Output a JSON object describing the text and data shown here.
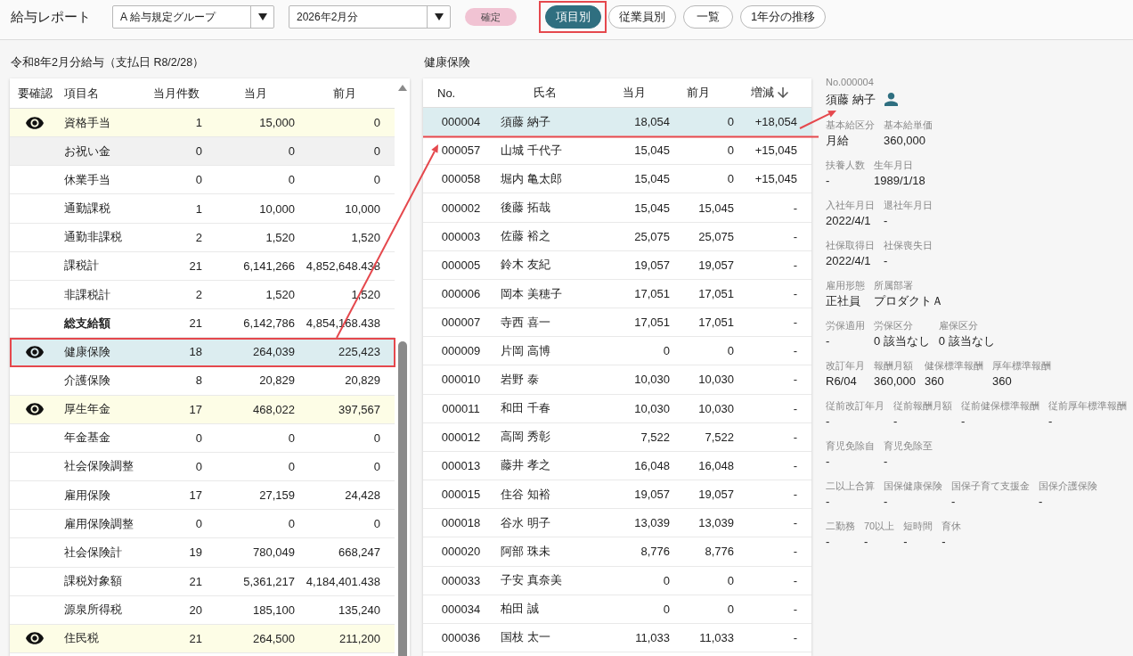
{
  "header": {
    "title": "給与レポート",
    "group_select": {
      "value": "A 給与規定グループ"
    },
    "month_select": {
      "value": "2026年2月分"
    },
    "status_badge": "確定",
    "view_buttons": [
      {
        "label": "項目別",
        "selected": true
      },
      {
        "label": "従業員別",
        "selected": false
      },
      {
        "label": "一覧",
        "selected": false
      },
      {
        "label": "1年分の推移",
        "selected": false
      }
    ]
  },
  "items_panel": {
    "title": "令和8年2月分給与（支払日 R8/2/28）",
    "columns": [
      "要確認",
      "項目名",
      "当月件数",
      "当月",
      "前月"
    ],
    "rows": [
      {
        "name": "資格手当",
        "count": "1",
        "current": "15,000",
        "previous": "0",
        "kind": "item",
        "flagged": true,
        "selected": false,
        "hovered": false
      },
      {
        "name": "お祝い金",
        "count": "0",
        "current": "0",
        "previous": "0",
        "kind": "item",
        "flagged": false,
        "selected": false,
        "hovered": true
      },
      {
        "name": "休業手当",
        "count": "0",
        "current": "0",
        "previous": "0",
        "kind": "item",
        "flagged": false,
        "selected": false,
        "hovered": false
      },
      {
        "name": "通勤課税",
        "count": "1",
        "current": "10,000",
        "previous": "10,000",
        "kind": "item",
        "flagged": false,
        "selected": false,
        "hovered": false
      },
      {
        "name": "通勤非課税",
        "count": "2",
        "current": "1,520",
        "previous": "1,520",
        "kind": "item",
        "flagged": false,
        "selected": false,
        "hovered": false
      },
      {
        "name": "課税計",
        "count": "21",
        "current": "6,141,266",
        "previous": "4,852,648.438",
        "kind": "item",
        "flagged": false,
        "selected": false,
        "hovered": false
      },
      {
        "name": "非課税計",
        "count": "2",
        "current": "1,520",
        "previous": "1,520",
        "kind": "item",
        "flagged": false,
        "selected": false,
        "hovered": false
      },
      {
        "name": "総支給額",
        "count": "21",
        "current": "6,142,786",
        "previous": "4,854,168.438",
        "kind": "total",
        "flagged": false,
        "selected": false,
        "hovered": false
      },
      {
        "name": "健康保険",
        "count": "18",
        "current": "264,039",
        "previous": "225,423",
        "kind": "item",
        "flagged": true,
        "selected": true,
        "hovered": false
      },
      {
        "name": "介護保険",
        "count": "8",
        "current": "20,829",
        "previous": "20,829",
        "kind": "item",
        "flagged": false,
        "selected": false,
        "hovered": false
      },
      {
        "name": "厚生年金",
        "count": "17",
        "current": "468,022",
        "previous": "397,567",
        "kind": "item",
        "flagged": true,
        "selected": false,
        "hovered": false
      },
      {
        "name": "年金基金",
        "count": "0",
        "current": "0",
        "previous": "0",
        "kind": "item",
        "flagged": false,
        "selected": false,
        "hovered": false
      },
      {
        "name": "社会保険調整",
        "count": "0",
        "current": "0",
        "previous": "0",
        "kind": "item",
        "flagged": false,
        "selected": false,
        "hovered": false
      },
      {
        "name": "雇用保険",
        "count": "17",
        "current": "27,159",
        "previous": "24,428",
        "kind": "item",
        "flagged": false,
        "selected": false,
        "hovered": false
      },
      {
        "name": "雇用保険調整",
        "count": "0",
        "current": "0",
        "previous": "0",
        "kind": "item",
        "flagged": false,
        "selected": false,
        "hovered": false
      },
      {
        "name": "社会保険計",
        "count": "19",
        "current": "780,049",
        "previous": "668,247",
        "kind": "item",
        "flagged": false,
        "selected": false,
        "hovered": false
      },
      {
        "name": "課税対象額",
        "count": "21",
        "current": "5,361,217",
        "previous": "4,184,401.438",
        "kind": "item",
        "flagged": false,
        "selected": false,
        "hovered": false
      },
      {
        "name": "源泉所得税",
        "count": "20",
        "current": "185,100",
        "previous": "135,240",
        "kind": "item",
        "flagged": false,
        "selected": false,
        "hovered": false
      },
      {
        "name": "住民税",
        "count": "21",
        "current": "264,500",
        "previous": "211,200",
        "kind": "item",
        "flagged": true,
        "selected": false,
        "hovered": false
      }
    ]
  },
  "employees_panel": {
    "title": "健康保険",
    "columns": [
      {
        "label": "No.",
        "sorted": false
      },
      {
        "label": "氏名",
        "sorted": false
      },
      {
        "label": "当月",
        "sorted": false
      },
      {
        "label": "前月",
        "sorted": false
      },
      {
        "label": "増減",
        "sorted": true
      }
    ],
    "rows": [
      {
        "no": "000004",
        "name": "須藤 納子",
        "current": "18,054",
        "previous": "0",
        "change": "+18,054",
        "selected": true
      },
      {
        "no": "000057",
        "name": "山城 千代子",
        "current": "15,045",
        "previous": "0",
        "change": "+15,045",
        "selected": false
      },
      {
        "no": "000058",
        "name": "堀内 亀太郎",
        "current": "15,045",
        "previous": "0",
        "change": "+15,045",
        "selected": false
      },
      {
        "no": "000002",
        "name": "後藤 拓哉",
        "current": "15,045",
        "previous": "15,045",
        "change": "-",
        "selected": false
      },
      {
        "no": "000003",
        "name": "佐藤 裕之",
        "current": "25,075",
        "previous": "25,075",
        "change": "-",
        "selected": false
      },
      {
        "no": "000005",
        "name": "鈴木 友紀",
        "current": "19,057",
        "previous": "19,057",
        "change": "-",
        "selected": false
      },
      {
        "no": "000006",
        "name": "岡本 美穂子",
        "current": "17,051",
        "previous": "17,051",
        "change": "-",
        "selected": false
      },
      {
        "no": "000007",
        "name": "寺西 喜一",
        "current": "17,051",
        "previous": "17,051",
        "change": "-",
        "selected": false
      },
      {
        "no": "000009",
        "name": "片岡 高博",
        "current": "0",
        "previous": "0",
        "change": "-",
        "selected": false
      },
      {
        "no": "000010",
        "name": "岩野 泰",
        "current": "10,030",
        "previous": "10,030",
        "change": "-",
        "selected": false
      },
      {
        "no": "000011",
        "name": "和田 千春",
        "current": "10,030",
        "previous": "10,030",
        "change": "-",
        "selected": false
      },
      {
        "no": "000012",
        "name": "高岡 秀彰",
        "current": "7,522",
        "previous": "7,522",
        "change": "-",
        "selected": false
      },
      {
        "no": "000013",
        "name": "藤井 孝之",
        "current": "16,048",
        "previous": "16,048",
        "change": "-",
        "selected": false
      },
      {
        "no": "000015",
        "name": "住谷 知裕",
        "current": "19,057",
        "previous": "19,057",
        "change": "-",
        "selected": false
      },
      {
        "no": "000018",
        "name": "谷水 明子",
        "current": "13,039",
        "previous": "13,039",
        "change": "-",
        "selected": false
      },
      {
        "no": "000020",
        "name": "阿部 珠未",
        "current": "8,776",
        "previous": "8,776",
        "change": "-",
        "selected": false
      },
      {
        "no": "000033",
        "name": "子安 真奈美",
        "current": "0",
        "previous": "0",
        "change": "-",
        "selected": false
      },
      {
        "no": "000034",
        "name": "柏田 誠",
        "current": "0",
        "previous": "0",
        "change": "-",
        "selected": false
      },
      {
        "no": "000036",
        "name": "国枝 太一",
        "current": "11,033",
        "previous": "11,033",
        "change": "-",
        "selected": false
      }
    ]
  },
  "detail": {
    "number": "No.000004",
    "name": "須藤 納子",
    "groups": [
      {
        "fields": [
          {
            "label": "基本給区分",
            "value": "月給"
          },
          {
            "label": "基本給単価",
            "value": "360,000"
          }
        ]
      },
      {
        "fields": [
          {
            "label": "扶養人数",
            "value": "-"
          },
          {
            "label": "生年月日",
            "value": "1989/1/18"
          }
        ]
      },
      {
        "fields": [
          {
            "label": "入社年月日",
            "value": "2022/4/1"
          },
          {
            "label": "退社年月日",
            "value": "-"
          }
        ]
      },
      {
        "fields": [
          {
            "label": "社保取得日",
            "value": "2022/4/1"
          },
          {
            "label": "社保喪失日",
            "value": "-"
          }
        ]
      },
      {
        "fields": [
          {
            "label": "雇用形態",
            "value": "正社員"
          },
          {
            "label": "所属部署",
            "value": "プロダクトＡ"
          }
        ]
      },
      {
        "fields": [
          {
            "label": "労保適用",
            "value": "-"
          },
          {
            "label": "労保区分",
            "value": "0 該当なし"
          },
          {
            "label": "雇保区分",
            "value": "0 該当なし"
          }
        ]
      },
      {
        "fields": [
          {
            "label": "改訂年月",
            "value": "R6/04"
          },
          {
            "label": "報酬月額",
            "value": "360,000"
          },
          {
            "label": "健保標準報酬",
            "value": "360"
          },
          {
            "label": "厚年標準報酬",
            "value": "360"
          }
        ]
      },
      {
        "fields": [
          {
            "label": "従前改訂年月",
            "value": "-"
          },
          {
            "label": "従前報酬月額",
            "value": "-"
          },
          {
            "label": "従前健保標準報酬",
            "value": "-"
          },
          {
            "label": "従前厚年標準報酬",
            "value": "-"
          }
        ]
      },
      {
        "fields": [
          {
            "label": "育児免除自",
            "value": "-"
          },
          {
            "label": "育児免除至",
            "value": "-"
          }
        ]
      },
      {
        "fields": [
          {
            "label": "二以上合算",
            "value": "-"
          },
          {
            "label": "国保健康保険",
            "value": "-"
          },
          {
            "label": "国保子育て支援金",
            "value": "-"
          },
          {
            "label": "国保介護保険",
            "value": "-"
          }
        ]
      },
      {
        "fields": [
          {
            "label": "二勤務",
            "value": "-"
          },
          {
            "label": "70以上",
            "value": "-"
          },
          {
            "label": "短時間",
            "value": "-"
          },
          {
            "label": "育休",
            "value": "-"
          }
        ]
      }
    ]
  }
}
